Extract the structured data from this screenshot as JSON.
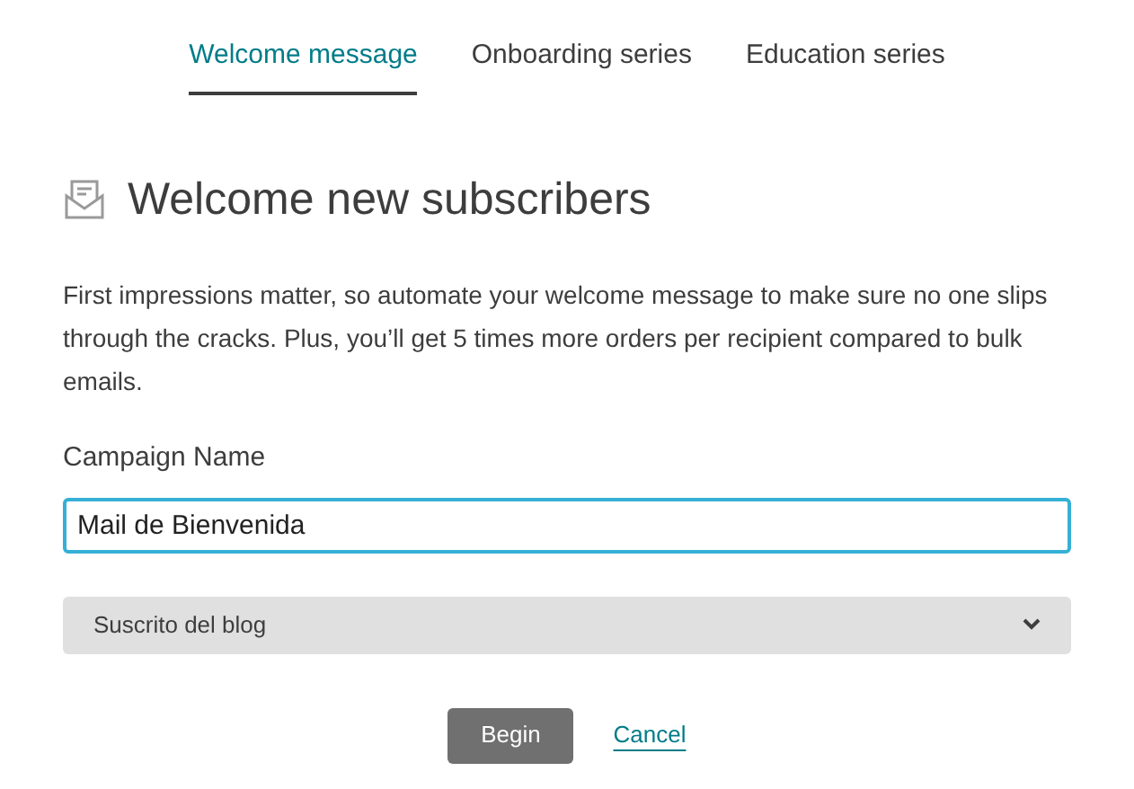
{
  "tabs": [
    {
      "label": "Welcome message",
      "selected": true
    },
    {
      "label": "Onboarding series",
      "selected": false
    },
    {
      "label": "Education series",
      "selected": false
    }
  ],
  "heading": "Welcome new subscribers",
  "description": "First impressions matter, so automate your welcome message to make sure no one slips through the cracks. Plus, you’ll get 5 times more orders per recipient compared to bulk emails.",
  "campaign_name": {
    "label": "Campaign Name",
    "value": "Mail de Bienvenida"
  },
  "list_select": {
    "value": "Suscrito del blog"
  },
  "buttons": {
    "begin": "Begin",
    "cancel": "Cancel"
  }
}
